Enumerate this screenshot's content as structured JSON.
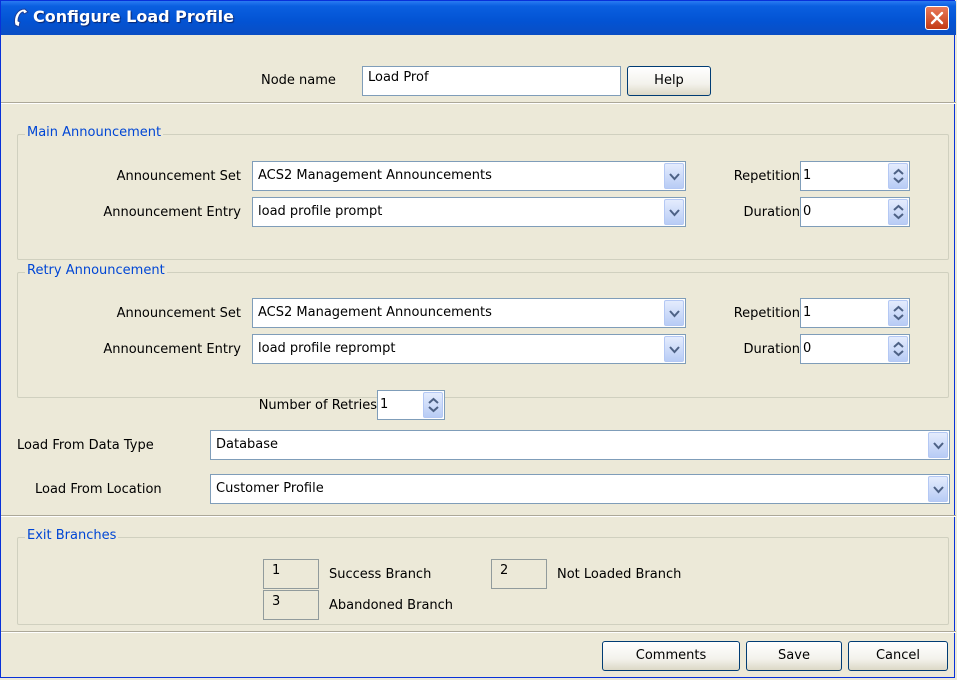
{
  "window": {
    "title": "Configure Load Profile"
  },
  "header": {
    "node_name_label": "Node name",
    "node_name_value": "Load Prof",
    "help_label": "Help"
  },
  "main_announcement": {
    "legend": "Main Announcement",
    "set_label": "Announcement Set",
    "set_value": "ACS2 Management Announcements",
    "entry_label": "Announcement Entry",
    "entry_value": "load profile prompt",
    "repetition_label": "Repetition",
    "repetition_value": "1",
    "duration_label": "Duration",
    "duration_value": "0"
  },
  "retry_announcement": {
    "legend": "Retry Announcement",
    "set_label": "Announcement Set",
    "set_value": "ACS2 Management Announcements",
    "entry_label": "Announcement Entry",
    "entry_value": "load profile reprompt",
    "repetition_label": "Repetition",
    "repetition_value": "1",
    "duration_label": "Duration",
    "duration_value": "0"
  },
  "retries": {
    "label": "Number of Retries",
    "value": "1"
  },
  "load_data_type": {
    "label": "Load From Data Type",
    "value": "Database"
  },
  "load_location": {
    "label": "Load From Location",
    "value": "Customer Profile"
  },
  "exit_branches": {
    "legend": "Exit Branches",
    "items": [
      {
        "num": "1",
        "label": "Success Branch"
      },
      {
        "num": "2",
        "label": "Not Loaded Branch"
      },
      {
        "num": "3",
        "label": "Abandoned Branch"
      }
    ]
  },
  "footer": {
    "comments_label": "Comments",
    "save_label": "Save",
    "cancel_label": "Cancel"
  },
  "colors": {
    "titlebar": "#0353d3",
    "legend_text": "#0046d5",
    "window_bg": "#ece9d8",
    "close_button": "#c33a14"
  }
}
